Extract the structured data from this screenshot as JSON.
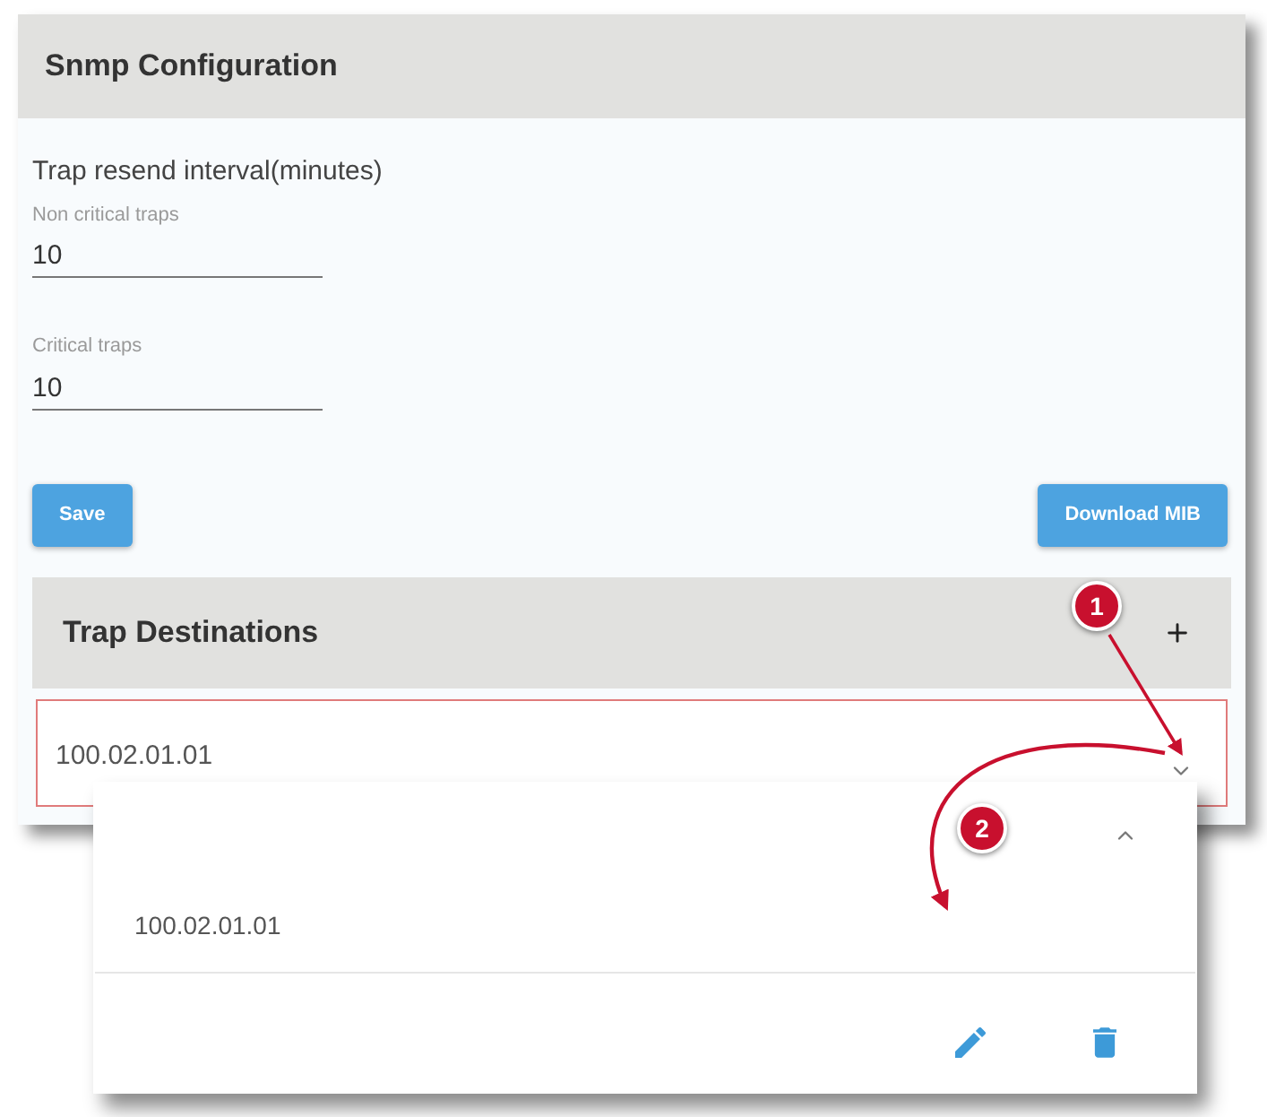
{
  "panel": {
    "title": "Snmp Configuration",
    "section_label": "Trap resend interval(minutes)",
    "fields": [
      {
        "label": "Non critical traps",
        "value": "10"
      },
      {
        "label": "Critical traps",
        "value": "10"
      }
    ],
    "buttons": [
      {
        "label": "Save"
      },
      {
        "label": "Download MIB"
      }
    ]
  },
  "trap_destinations": {
    "title": "Trap Destinations",
    "rows": [
      {
        "address": "100.02.01.01",
        "expanded": false,
        "highlighted": true
      }
    ]
  },
  "zoomed_row": {
    "address": "100.02.01.01",
    "expanded": true,
    "highlighted": false
  },
  "callouts": [
    {
      "number": "1"
    },
    {
      "number": "2"
    }
  ]
}
